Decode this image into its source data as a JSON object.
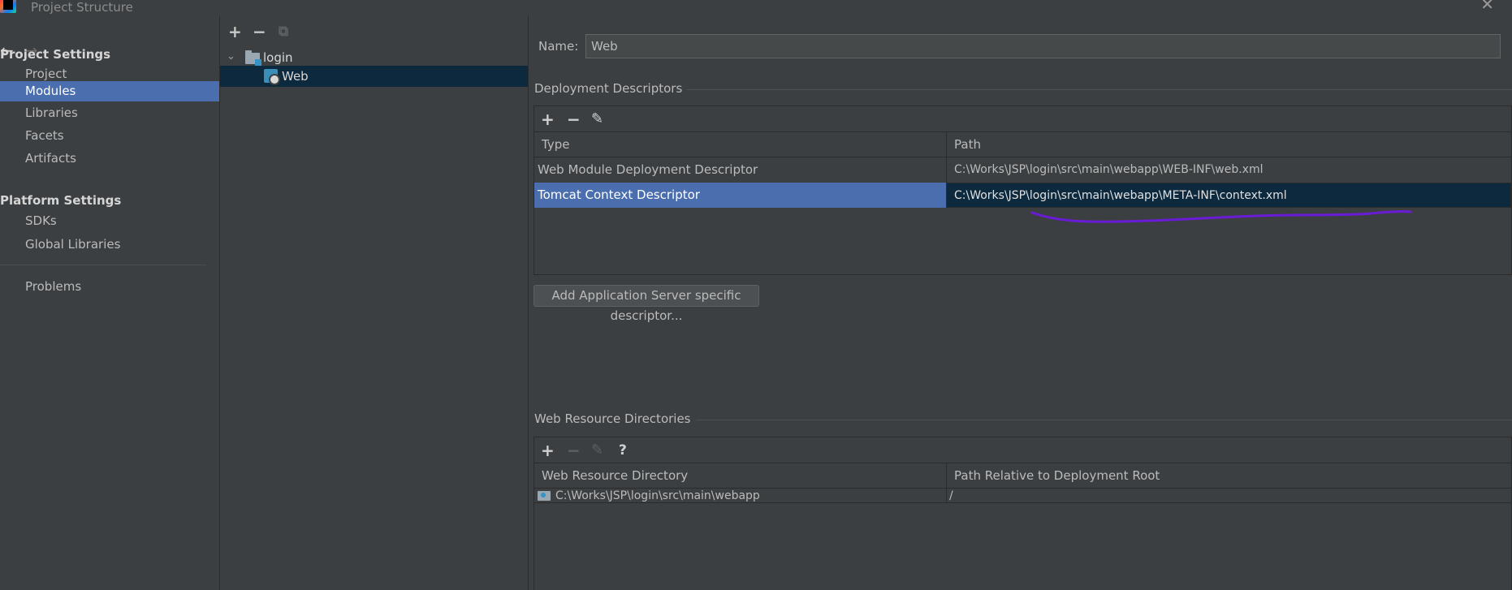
{
  "window": {
    "title": "Project Structure",
    "close_label": "✕"
  },
  "left": {
    "back_label": "←",
    "forward_label": "→",
    "project_settings": "Project Settings",
    "project_items": [
      "Project",
      "Modules",
      "Libraries",
      "Facets",
      "Artifacts"
    ],
    "platform_settings": "Platform Settings",
    "platform_items": [
      "SDKs",
      "Global Libraries"
    ],
    "problems": "Problems",
    "selected": "Modules"
  },
  "middle": {
    "add_label": "+",
    "remove_label": "−",
    "copy_label": "⧉",
    "tree": {
      "root": "login",
      "child": "Web"
    }
  },
  "right": {
    "name_label": "Name:",
    "name_value": "Web",
    "deployment": {
      "title": "Deployment Descriptors",
      "toolbar": [
        "+",
        "−",
        "✎"
      ],
      "columns": [
        "Type",
        "Path"
      ],
      "rows": [
        {
          "type": "Web Module Deployment Descriptor",
          "path": "C:\\Works\\JSP\\login\\src\\main\\webapp\\WEB-INF\\web.xml"
        },
        {
          "type": "Tomcat Context Descriptor",
          "path": "C:\\Works\\JSP\\login\\src\\main\\webapp\\META-INF\\context.xml"
        }
      ],
      "selected_row": 1
    },
    "add_server_button": "Add Application Server specific descriptor...",
    "web_resources": {
      "title": "Web Resource Directories",
      "toolbar": [
        "+",
        "−",
        "✎",
        "?"
      ],
      "columns": [
        "Web Resource Directory",
        "Path Relative to Deployment Root"
      ],
      "rows": [
        {
          "directory": "C:\\Works\\JSP\\login\\src\\main\\webapp",
          "relative": "/"
        }
      ]
    }
  },
  "colors": {
    "background": "#3c3f41",
    "selection": "#4b6eaf",
    "tree_selection": "#0d293e",
    "annotation": "#6a1bd6"
  }
}
